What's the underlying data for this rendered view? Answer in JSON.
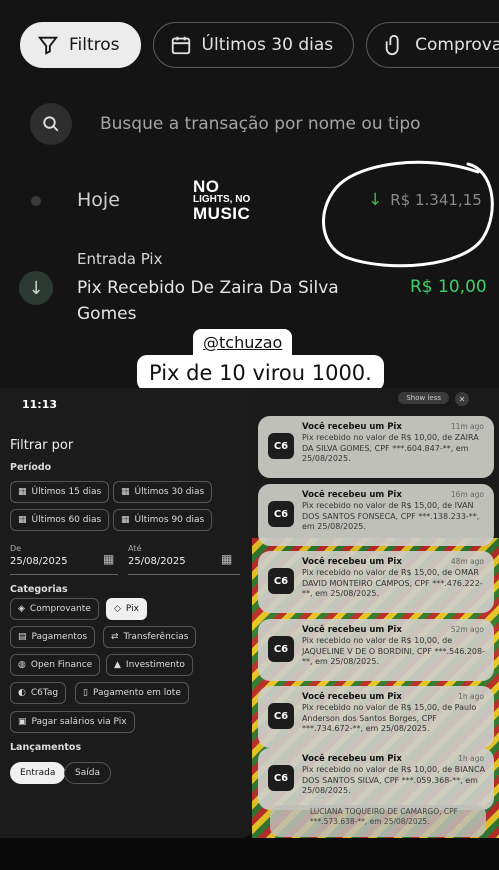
{
  "top": {
    "chips": [
      {
        "label": "Filtros",
        "icon": "filter-icon",
        "active": true
      },
      {
        "label": "Últimos 30 dias",
        "icon": "calendar-icon",
        "active": false
      },
      {
        "label": "Comprova",
        "icon": "paperclip-icon",
        "active": false
      }
    ],
    "search_placeholder": "Busque a transação por nome ou tipo",
    "section_label": "Hoje",
    "logo": {
      "line1": "NO",
      "line2": "LIGHTS, NO",
      "line3": "MUSIC"
    },
    "day_total": "R$ 1.341,15",
    "transaction": {
      "kind": "Entrada Pix",
      "name": "Pix Recebido De Zaira Da Silva Gomes",
      "amount": "R$ 10,00"
    }
  },
  "caption": {
    "handle": "@tchuzao",
    "text": "Pix de 10 virou 1000."
  },
  "filter_panel": {
    "status_time": "11:13",
    "title": "Filtrar por",
    "period_label": "Período",
    "periods": [
      "Últimos 15 dias",
      "Últimos 30 dias",
      "Últimos 60 dias",
      "Últimos 90 dias"
    ],
    "from_label": "De",
    "from_value": "25/08/2025",
    "to_label": "Até",
    "to_value": "25/08/2025",
    "categories_label": "Categorias",
    "categories": [
      {
        "label": "Comprovante",
        "selected": false
      },
      {
        "label": "Pix",
        "selected": true
      },
      {
        "label": "Pagamentos",
        "selected": false
      },
      {
        "label": "Transferências",
        "selected": false
      },
      {
        "label": "Open Finance",
        "selected": false
      },
      {
        "label": "Investimento",
        "selected": false
      },
      {
        "label": "C6Tag",
        "selected": false
      },
      {
        "label": "Pagamento em lote",
        "selected": false
      },
      {
        "label": "Pagar salários via Pix",
        "selected": false
      }
    ],
    "entries_label": "Lançamentos",
    "entries": [
      {
        "label": "Entrada",
        "selected": true
      },
      {
        "label": "Saída",
        "selected": false
      }
    ]
  },
  "notifications": {
    "show_less": "Show less",
    "items": [
      {
        "logo": "C6",
        "title": "Você recebeu um Pix",
        "time": "11m ago",
        "body": "Pix recebido no valor de R$ 10,00, de ZAIRA DA SILVA GOMES, CPF ***.604.847-**, em 25/08/2025."
      },
      {
        "logo": "C6",
        "title": "Você recebeu um Pix",
        "time": "16m ago",
        "body": "Pix recebido no valor de R$ 15,00, de IVAN DOS SANTOS FONSECA, CPF ***.138.233-**, em 25/08/2025."
      },
      {
        "logo": "C6",
        "title": "Você recebeu um Pix",
        "time": "48m ago",
        "body": "Pix recebido no valor de R$ 15,00, de OMAR DAVID MONTEIRO CAMPOS, CPF ***.476.222-**, em 25/08/2025."
      },
      {
        "logo": "C6",
        "title": "Você recebeu um Pix",
        "time": "52m ago",
        "body": "Pix recebido no valor de R$ 10,00, de JAQUELINE V DE O BORDINI, CPF ***.546.208-**, em 25/08/2025."
      },
      {
        "logo": "C6",
        "title": "Você recebeu um Pix",
        "time": "1h ago",
        "body": "Pix recebido no valor de R$ 15,00, de Paulo Anderson dos Santos Borges, CPF ***.734.672-**, em 25/08/2025."
      },
      {
        "logo": "C6",
        "title": "Você recebeu um Pix",
        "time": "1h ago",
        "body": "Pix recebido no valor de R$ 10,00, de BIANCA DOS SANTOS SILVA, CPF ***.059.368-**, em 25/08/2025."
      }
    ],
    "peek_body": "LUCIANA TOQUEIRO DE CAMARGO, CPF ***.573.638-**, em 25/08/2025."
  },
  "colors": {
    "positive_green": "#3ecf6a",
    "chip_active_bg": "#ececec",
    "panel_bg": "#141414"
  }
}
